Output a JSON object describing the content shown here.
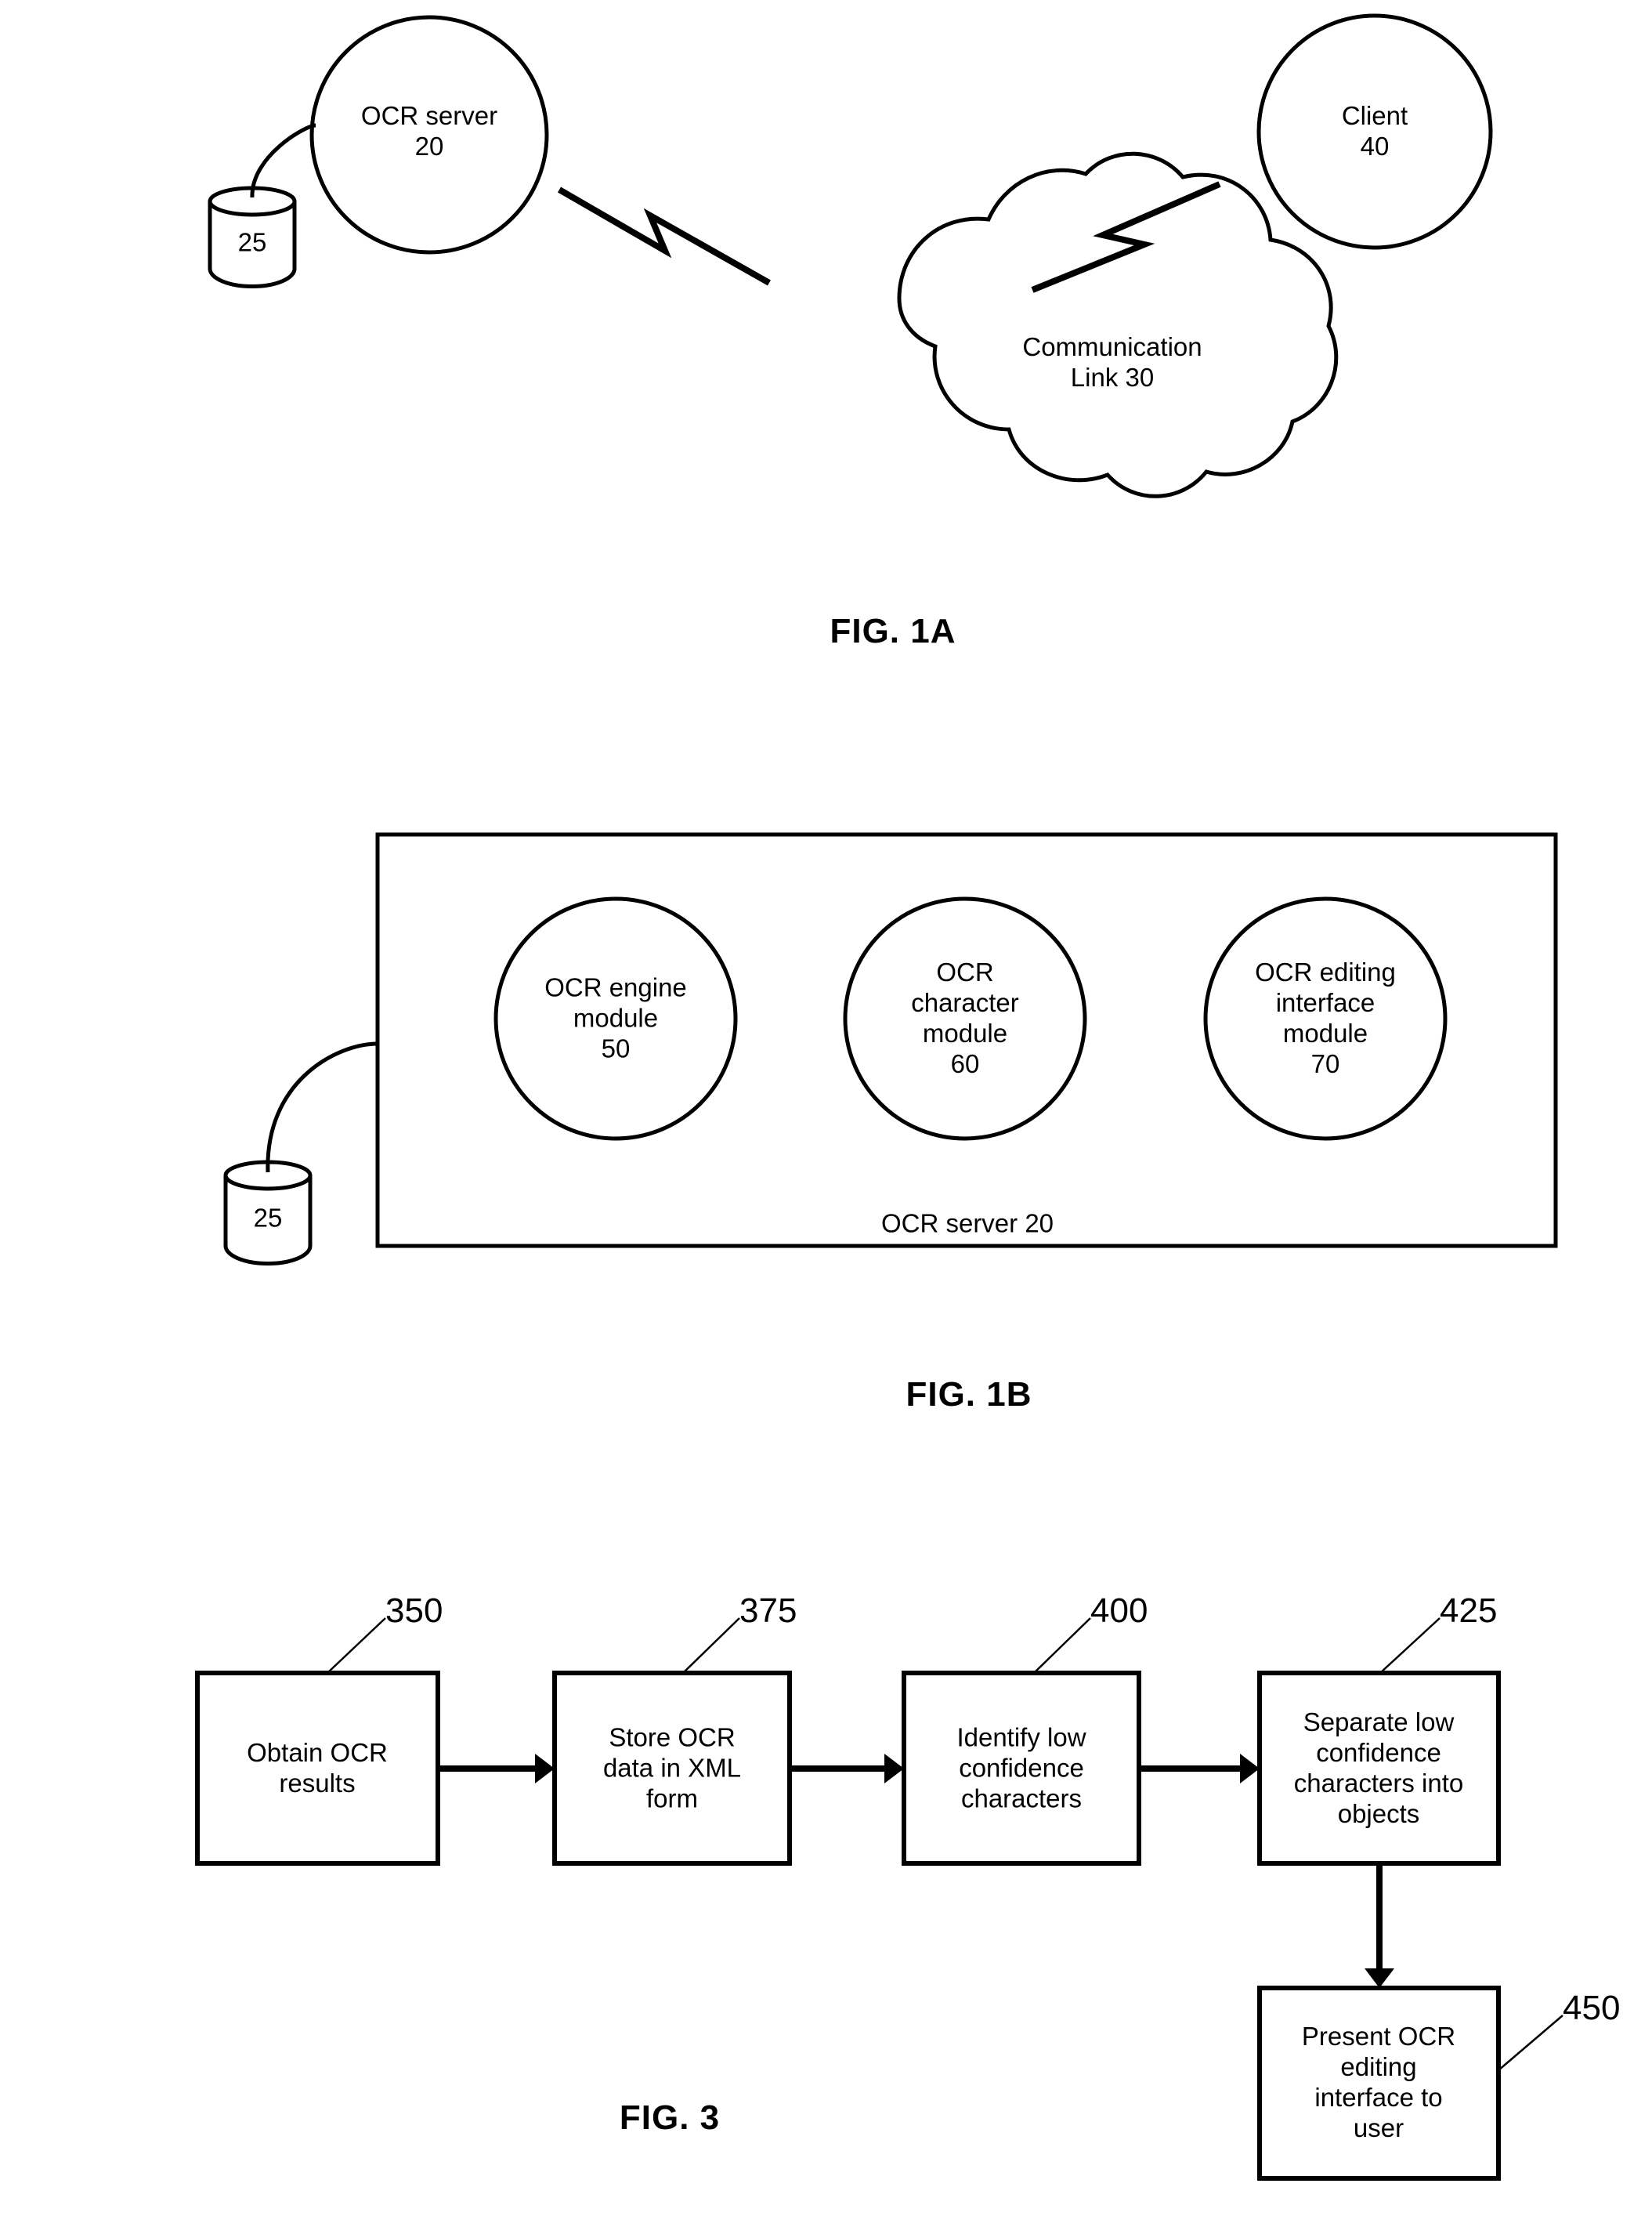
{
  "document": {
    "kind": "patent-drawing-sheet",
    "figures": [
      "FIG. 1A",
      "FIG. 1B",
      "FIG. 3"
    ]
  },
  "fig1a": {
    "caption": "FIG. 1A",
    "ocr_server": {
      "label": "OCR server\n20",
      "name": "OCR server",
      "ref": "20"
    },
    "database": {
      "label": "25",
      "ref": "25"
    },
    "cloud": {
      "label": "Communication\nLink 30",
      "name": "Communication Link",
      "ref": "30"
    },
    "client": {
      "label": "Client\n40",
      "name": "Client",
      "ref": "40"
    },
    "connectors": [
      "lightning-left",
      "lightning-right",
      "db-link"
    ]
  },
  "fig1b": {
    "caption": "FIG. 1B",
    "container_label": "OCR server 20",
    "database": {
      "label": "25",
      "ref": "25"
    },
    "modules": [
      {
        "label": "OCR engine\nmodule\n50",
        "name": "OCR engine module",
        "ref": "50"
      },
      {
        "label": "OCR\ncharacter\nmodule\n60",
        "name": "OCR character module",
        "ref": "60"
      },
      {
        "label": "OCR editing\ninterface\nmodule\n70",
        "name": "OCR editing interface module",
        "ref": "70"
      }
    ]
  },
  "fig3": {
    "caption": "FIG. 3",
    "steps": [
      {
        "label": "Obtain OCR\nresults",
        "ref": "350"
      },
      {
        "label": "Store OCR\ndata in XML\nform",
        "ref": "375"
      },
      {
        "label": "Identify low\nconfidence\ncharacters",
        "ref": "400"
      },
      {
        "label": "Separate low\nconfidence\ncharacters into\nobjects",
        "ref": "425"
      },
      {
        "label": "Present OCR\nediting\ninterface to\nuser",
        "ref": "450"
      }
    ],
    "flow": [
      "350 -> 375",
      "375 -> 400",
      "400 -> 425",
      "425 -> 450"
    ]
  },
  "style": {
    "stroke": "#000000",
    "background": "#ffffff"
  }
}
